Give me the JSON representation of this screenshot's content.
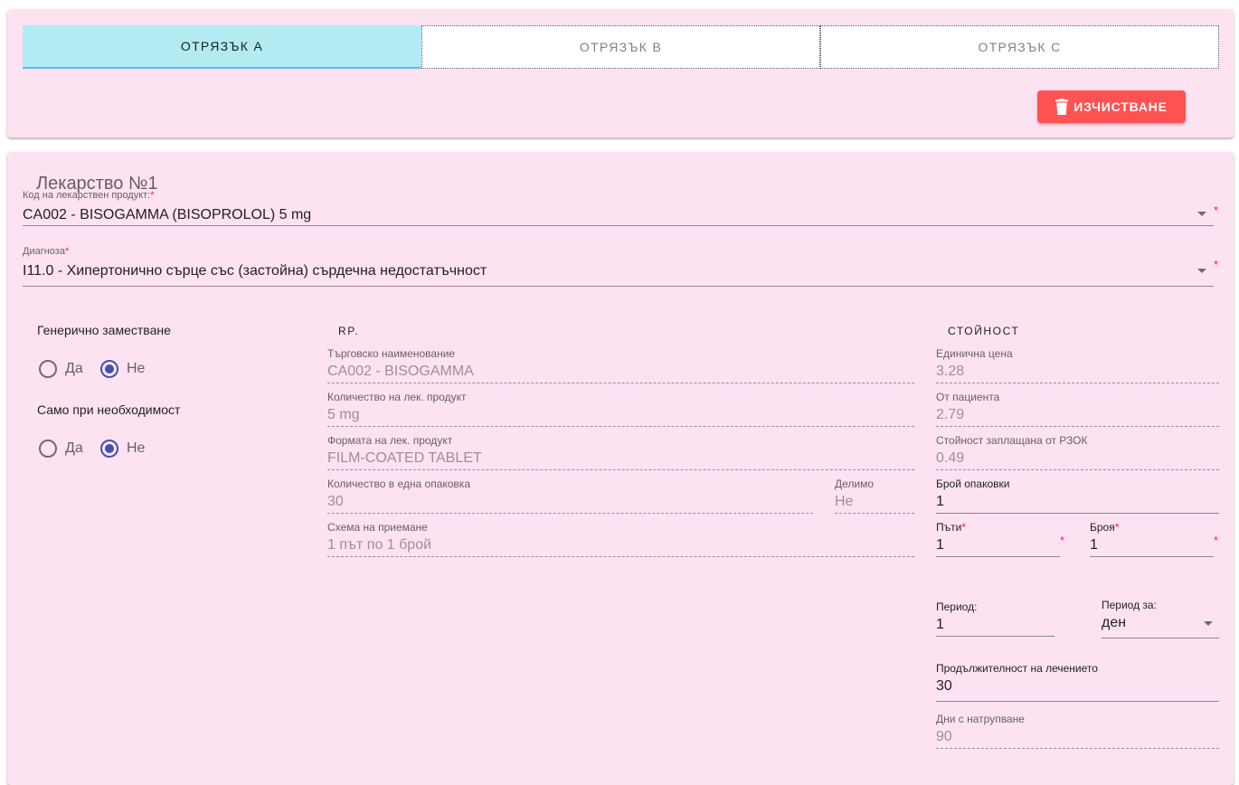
{
  "tabs": [
    {
      "label": "ОТРЯЗЪК А"
    },
    {
      "label": "ОТРЯЗЪК В"
    },
    {
      "label": "ОТРЯЗЪК С"
    }
  ],
  "clear_button": {
    "label": "ИЗЧИСТВАНЕ",
    "icon": "trash-icon"
  },
  "medicine": {
    "title": "Лекарство №1",
    "product_code": {
      "label": "Код на лекарствен продукт:",
      "value": "CA002 - BISOGAMMA (BISOPROLOL) 5 mg"
    },
    "diagnosis": {
      "label": "Диагноза",
      "value": "I11.0 - Хипертонично сърце със (застойна) сърдечна недостатъчност"
    },
    "required_mark": "*"
  },
  "options": {
    "generic": {
      "label": "Генерично заместване",
      "yes": "Да",
      "no": "Не",
      "selected": "no"
    },
    "as_needed": {
      "label": "Само при необходимост",
      "yes": "Да",
      "no": "Не",
      "selected": "no"
    }
  },
  "rp": {
    "title": "RP.",
    "trade_name": {
      "label": "Търговско наименование",
      "value": "CA002 - BISOGAMMA"
    },
    "quantity": {
      "label": "Количество на лек. продукт",
      "value": "5 mg"
    },
    "form": {
      "label": "Формата на лек. продукт",
      "value": "FILM-COATED TABLET"
    },
    "pack_qty": {
      "label": "Количество в една опаковка",
      "value": "30"
    },
    "divisible": {
      "label": "Делимо",
      "value": "Не"
    },
    "scheme": {
      "label": "Схема на приемане",
      "value": "1 път по 1 брой"
    }
  },
  "cost": {
    "title": "СТОЙНОСТ",
    "unit_price": {
      "label": "Единична цена",
      "value": "3.28"
    },
    "patient": {
      "label": "От пациента",
      "value": "2.79"
    },
    "rzok": {
      "label": "Стойност заплащана от РЗОК",
      "value": "0.49"
    },
    "packs": {
      "label": "Брой опаковки",
      "value": "1"
    },
    "times": {
      "label": "Пъти",
      "value": "1"
    },
    "count": {
      "label": "Броя",
      "value": "1"
    },
    "period": {
      "label": "Период:",
      "value": "1"
    },
    "period_for": {
      "label": "Период за:",
      "value": "ден"
    },
    "duration": {
      "label": "Продължителност на лечението",
      "value": "30"
    },
    "days_accum": {
      "label": "Дни с натрупване",
      "value": "90"
    }
  },
  "colors": {
    "accent": "#3f51b5",
    "danger": "#ff5252",
    "active_tab": "#b3ebf2",
    "card": "#fde3f2"
  }
}
